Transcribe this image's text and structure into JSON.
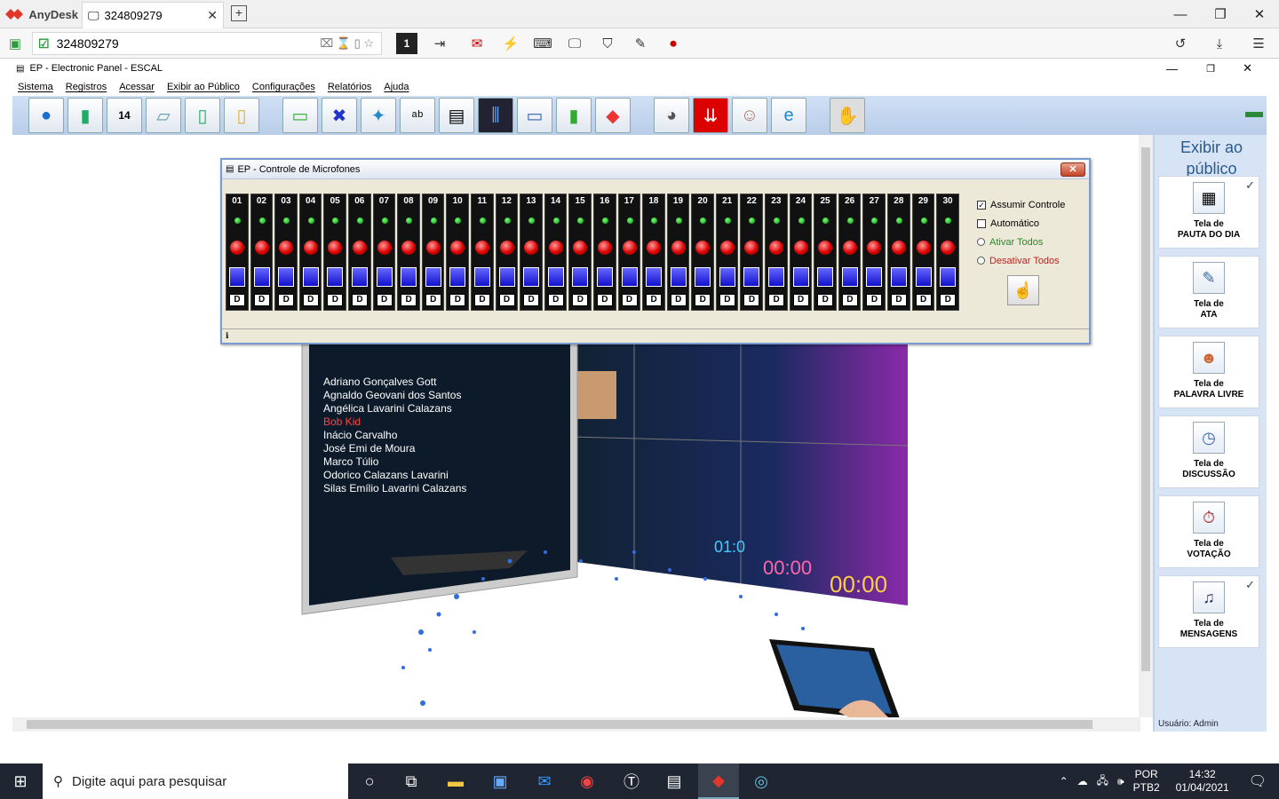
{
  "anydesk": {
    "app_name": "AnyDesk",
    "tab_label": "324809279",
    "address": "324809279",
    "colors": {
      "brand": "#e2362b"
    }
  },
  "app": {
    "title": "EP - Electronic Panel - ESCAL",
    "menu": [
      "Sistema",
      "Registros",
      "Acessar",
      "Exibir ao Público",
      "Configurações",
      "Relatórios",
      "Ajuda"
    ]
  },
  "panel": {
    "title": "Exibir ao público",
    "cards": [
      {
        "l1": "Tela de",
        "l2": "PAUTA DO DIA",
        "icon": "calendar-icon",
        "checked": "✓"
      },
      {
        "l1": "Tela de",
        "l2": "ATA",
        "icon": "document-icon",
        "checked": ""
      },
      {
        "l1": "Tela de",
        "l2": "PALAVRA LIVRE",
        "icon": "people-icon",
        "checked": ""
      },
      {
        "l1": "Tela de",
        "l2": "DISCUSSÃO",
        "icon": "clock-icon",
        "checked": ""
      },
      {
        "l1": "Tela de",
        "l2": "VOTAÇÃO",
        "icon": "timer-icon",
        "checked": ""
      },
      {
        "l1": "Tela de",
        "l2": "MENSAGENS",
        "icon": "music-icon",
        "checked": "✓"
      }
    ],
    "user": "Usuário: Admin"
  },
  "mic_dialog": {
    "title": "EP - Controle de Microfones",
    "channels": [
      "01",
      "02",
      "03",
      "04",
      "05",
      "06",
      "07",
      "08",
      "09",
      "10",
      "11",
      "12",
      "13",
      "14",
      "15",
      "16",
      "17",
      "18",
      "19",
      "20",
      "21",
      "22",
      "23",
      "24",
      "25",
      "26",
      "27",
      "28",
      "29",
      "30"
    ],
    "channel_button": "D",
    "assumir_controle": "Assumir Controle",
    "assumir_checked": "✓",
    "automatico": "Automático",
    "ativar_todos": "Ativar Todos",
    "desativar_todos": "Desativar Todos",
    "status": "ℹ"
  },
  "taskbar": {
    "search_placeholder": "Digite aqui para pesquisar",
    "lang1": "POR",
    "lang2": "PTB2",
    "time": "14:32",
    "date": "01/04/2021"
  }
}
